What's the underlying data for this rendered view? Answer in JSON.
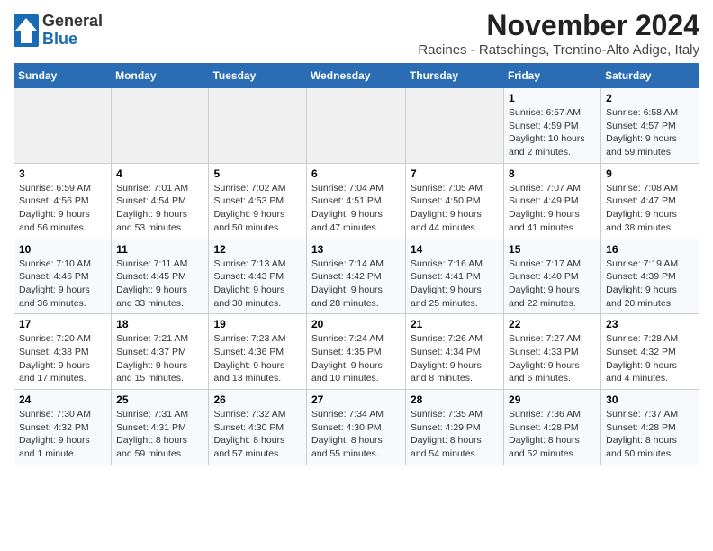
{
  "logo": {
    "general": "General",
    "blue": "Blue"
  },
  "title": "November 2024",
  "location": "Racines - Ratschings, Trentino-Alto Adige, Italy",
  "days_of_week": [
    "Sunday",
    "Monday",
    "Tuesday",
    "Wednesday",
    "Thursday",
    "Friday",
    "Saturday"
  ],
  "weeks": [
    [
      {
        "day": "",
        "info": ""
      },
      {
        "day": "",
        "info": ""
      },
      {
        "day": "",
        "info": ""
      },
      {
        "day": "",
        "info": ""
      },
      {
        "day": "",
        "info": ""
      },
      {
        "day": "1",
        "info": "Sunrise: 6:57 AM\nSunset: 4:59 PM\nDaylight: 10 hours and 2 minutes."
      },
      {
        "day": "2",
        "info": "Sunrise: 6:58 AM\nSunset: 4:57 PM\nDaylight: 9 hours and 59 minutes."
      }
    ],
    [
      {
        "day": "3",
        "info": "Sunrise: 6:59 AM\nSunset: 4:56 PM\nDaylight: 9 hours and 56 minutes."
      },
      {
        "day": "4",
        "info": "Sunrise: 7:01 AM\nSunset: 4:54 PM\nDaylight: 9 hours and 53 minutes."
      },
      {
        "day": "5",
        "info": "Sunrise: 7:02 AM\nSunset: 4:53 PM\nDaylight: 9 hours and 50 minutes."
      },
      {
        "day": "6",
        "info": "Sunrise: 7:04 AM\nSunset: 4:51 PM\nDaylight: 9 hours and 47 minutes."
      },
      {
        "day": "7",
        "info": "Sunrise: 7:05 AM\nSunset: 4:50 PM\nDaylight: 9 hours and 44 minutes."
      },
      {
        "day": "8",
        "info": "Sunrise: 7:07 AM\nSunset: 4:49 PM\nDaylight: 9 hours and 41 minutes."
      },
      {
        "day": "9",
        "info": "Sunrise: 7:08 AM\nSunset: 4:47 PM\nDaylight: 9 hours and 38 minutes."
      }
    ],
    [
      {
        "day": "10",
        "info": "Sunrise: 7:10 AM\nSunset: 4:46 PM\nDaylight: 9 hours and 36 minutes."
      },
      {
        "day": "11",
        "info": "Sunrise: 7:11 AM\nSunset: 4:45 PM\nDaylight: 9 hours and 33 minutes."
      },
      {
        "day": "12",
        "info": "Sunrise: 7:13 AM\nSunset: 4:43 PM\nDaylight: 9 hours and 30 minutes."
      },
      {
        "day": "13",
        "info": "Sunrise: 7:14 AM\nSunset: 4:42 PM\nDaylight: 9 hours and 28 minutes."
      },
      {
        "day": "14",
        "info": "Sunrise: 7:16 AM\nSunset: 4:41 PM\nDaylight: 9 hours and 25 minutes."
      },
      {
        "day": "15",
        "info": "Sunrise: 7:17 AM\nSunset: 4:40 PM\nDaylight: 9 hours and 22 minutes."
      },
      {
        "day": "16",
        "info": "Sunrise: 7:19 AM\nSunset: 4:39 PM\nDaylight: 9 hours and 20 minutes."
      }
    ],
    [
      {
        "day": "17",
        "info": "Sunrise: 7:20 AM\nSunset: 4:38 PM\nDaylight: 9 hours and 17 minutes."
      },
      {
        "day": "18",
        "info": "Sunrise: 7:21 AM\nSunset: 4:37 PM\nDaylight: 9 hours and 15 minutes."
      },
      {
        "day": "19",
        "info": "Sunrise: 7:23 AM\nSunset: 4:36 PM\nDaylight: 9 hours and 13 minutes."
      },
      {
        "day": "20",
        "info": "Sunrise: 7:24 AM\nSunset: 4:35 PM\nDaylight: 9 hours and 10 minutes."
      },
      {
        "day": "21",
        "info": "Sunrise: 7:26 AM\nSunset: 4:34 PM\nDaylight: 9 hours and 8 minutes."
      },
      {
        "day": "22",
        "info": "Sunrise: 7:27 AM\nSunset: 4:33 PM\nDaylight: 9 hours and 6 minutes."
      },
      {
        "day": "23",
        "info": "Sunrise: 7:28 AM\nSunset: 4:32 PM\nDaylight: 9 hours and 4 minutes."
      }
    ],
    [
      {
        "day": "24",
        "info": "Sunrise: 7:30 AM\nSunset: 4:32 PM\nDaylight: 9 hours and 1 minute."
      },
      {
        "day": "25",
        "info": "Sunrise: 7:31 AM\nSunset: 4:31 PM\nDaylight: 8 hours and 59 minutes."
      },
      {
        "day": "26",
        "info": "Sunrise: 7:32 AM\nSunset: 4:30 PM\nDaylight: 8 hours and 57 minutes."
      },
      {
        "day": "27",
        "info": "Sunrise: 7:34 AM\nSunset: 4:30 PM\nDaylight: 8 hours and 55 minutes."
      },
      {
        "day": "28",
        "info": "Sunrise: 7:35 AM\nSunset: 4:29 PM\nDaylight: 8 hours and 54 minutes."
      },
      {
        "day": "29",
        "info": "Sunrise: 7:36 AM\nSunset: 4:28 PM\nDaylight: 8 hours and 52 minutes."
      },
      {
        "day": "30",
        "info": "Sunrise: 7:37 AM\nSunset: 4:28 PM\nDaylight: 8 hours and 50 minutes."
      }
    ]
  ]
}
